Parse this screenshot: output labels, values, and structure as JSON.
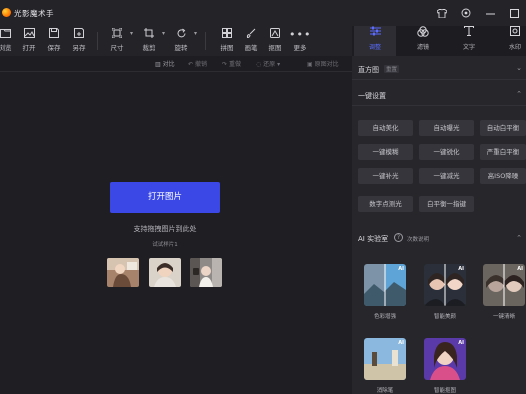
{
  "app": {
    "title": "光影魔术手"
  },
  "window_icons": [
    "shirt-icon",
    "settings-icon",
    "minimize-icon",
    "maximize-icon"
  ],
  "toolbar": {
    "items": [
      {
        "icon": "browse-icon",
        "label": "浏览"
      },
      {
        "icon": "open-icon",
        "label": "打开"
      },
      {
        "icon": "save-icon",
        "label": "保存"
      },
      {
        "icon": "save-as-icon",
        "label": "另存"
      },
      {
        "icon": "size-icon",
        "label": "尺寸"
      },
      {
        "icon": "crop-icon",
        "label": "裁剪"
      },
      {
        "icon": "rotate-icon",
        "label": "旋转"
      },
      {
        "icon": "collage-icon",
        "label": "拼图"
      },
      {
        "icon": "brush-icon",
        "label": "画笔"
      },
      {
        "icon": "frame-icon",
        "label": "抠图"
      },
      {
        "icon": "more-icon",
        "label": "更多"
      }
    ]
  },
  "subbar": {
    "compare": "对比",
    "undo": "撤销",
    "redo": "重做",
    "restore": "还原",
    "original": "原图对比"
  },
  "canvas": {
    "open_button": "打开图片",
    "drag_hint": "支持拖拽图片到此处",
    "sample_label": "试试样片1"
  },
  "panel": {
    "tabs": [
      {
        "icon": "adjust-icon",
        "label": "调整",
        "active": true
      },
      {
        "icon": "filter-icon",
        "label": "滤镜",
        "active": false
      },
      {
        "icon": "text-icon",
        "label": "文字",
        "active": false
      },
      {
        "icon": "watermark-icon",
        "label": "水印",
        "active": false
      }
    ],
    "histogram": {
      "title": "直方图",
      "reset": "重置"
    },
    "one_click": {
      "title": "一键设置",
      "buttons": [
        "自动美化",
        "自动曝光",
        "自动白平衡",
        "一键模糊",
        "一键锐化",
        "严重白平衡",
        "一键补光",
        "一键减光",
        "高ISO降噪",
        "数字点测光",
        "白平衡一指键"
      ]
    },
    "ai": {
      "title": "AI 实验室",
      "help": "次数说明",
      "cards": [
        {
          "label": "色彩增强",
          "badge": "AI"
        },
        {
          "label": "智能美颜",
          "badge": "AI"
        },
        {
          "label": "一键清晰",
          "badge": "AI"
        },
        {
          "label": "消除笔",
          "badge": "AI"
        },
        {
          "label": "智能抠图",
          "badge": "AI"
        }
      ]
    }
  },
  "colors": {
    "accent": "#3b48e6",
    "active_tab": "#5b6cff",
    "panel_bg": "#26262b",
    "canvas_bg": "#1f1f23"
  }
}
